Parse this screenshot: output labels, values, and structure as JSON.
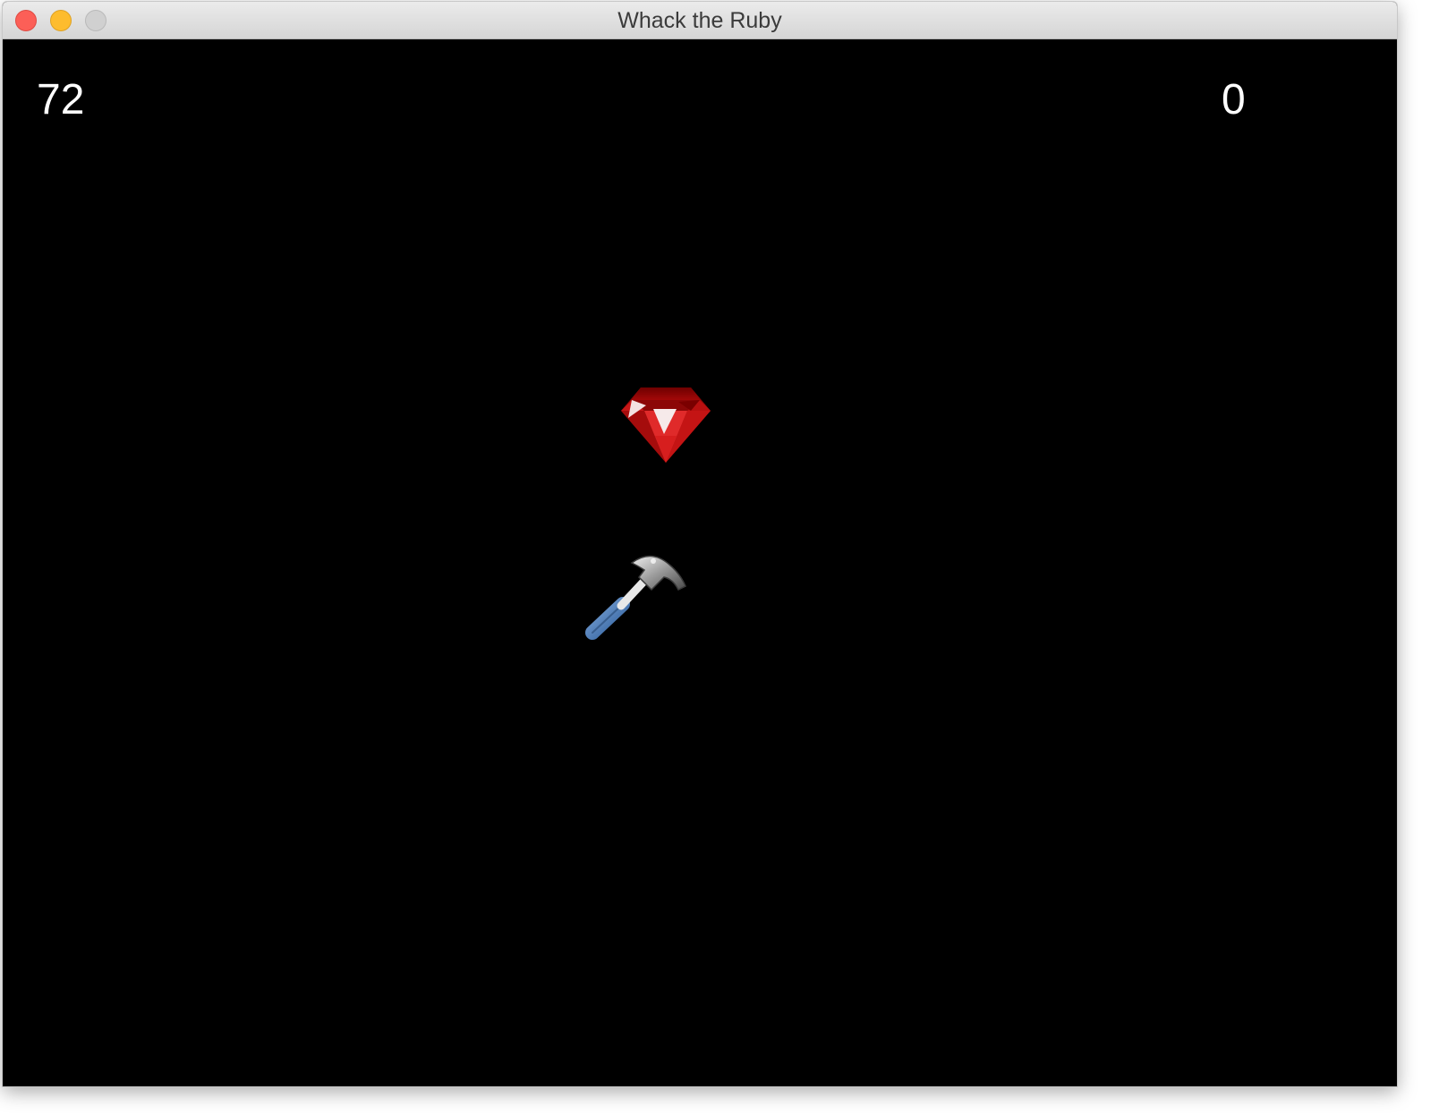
{
  "window": {
    "title": "Whack the Ruby"
  },
  "hud": {
    "time_remaining": "72",
    "score": "0"
  },
  "sprites": {
    "ruby": "ruby-icon",
    "hammer": "hammer-icon"
  },
  "colors": {
    "background": "#000000",
    "hud_text": "#ffffff",
    "ruby": "#b30d0d"
  }
}
